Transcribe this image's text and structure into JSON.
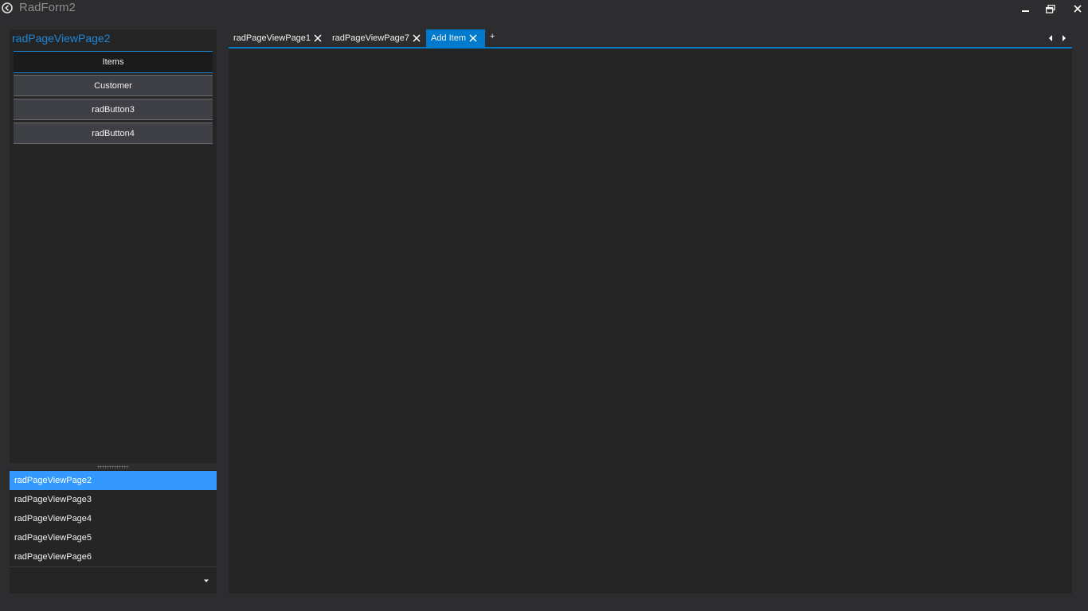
{
  "window": {
    "title": "RadForm2",
    "icons": {
      "app": "app-icon",
      "minimize": "minimize-icon",
      "restore": "restore-icon",
      "close": "close-icon"
    }
  },
  "nav": {
    "title": "radPageViewPage2",
    "buttons": [
      {
        "label": "Items",
        "active": true
      },
      {
        "label": "Customer",
        "active": false
      },
      {
        "label": "radButton3",
        "active": false
      },
      {
        "label": "radButton4",
        "active": false
      }
    ]
  },
  "page_list": {
    "items": [
      {
        "label": "radPageViewPage2",
        "selected": true
      },
      {
        "label": "radPageViewPage3",
        "selected": false
      },
      {
        "label": "radPageViewPage4",
        "selected": false
      },
      {
        "label": "radPageViewPage5",
        "selected": false
      },
      {
        "label": "radPageViewPage6",
        "selected": false
      }
    ],
    "overflow_icon": "chevron-down-icon"
  },
  "tabs": {
    "items": [
      {
        "label": "radPageViewPage1",
        "selected": false,
        "closable": true
      },
      {
        "label": "radPageViewPage7",
        "selected": false,
        "closable": true
      },
      {
        "label": "Add Item",
        "selected": true,
        "closable": true
      }
    ],
    "new_tab_label": "+",
    "scroll_icons": [
      "scroll-left-icon",
      "scroll-right-icon"
    ]
  },
  "colors": {
    "accent": "#007acc",
    "title_accent": "#1e86d6",
    "selected_item": "#3399ff",
    "background": "#2d2d30",
    "panel": "#252526"
  }
}
